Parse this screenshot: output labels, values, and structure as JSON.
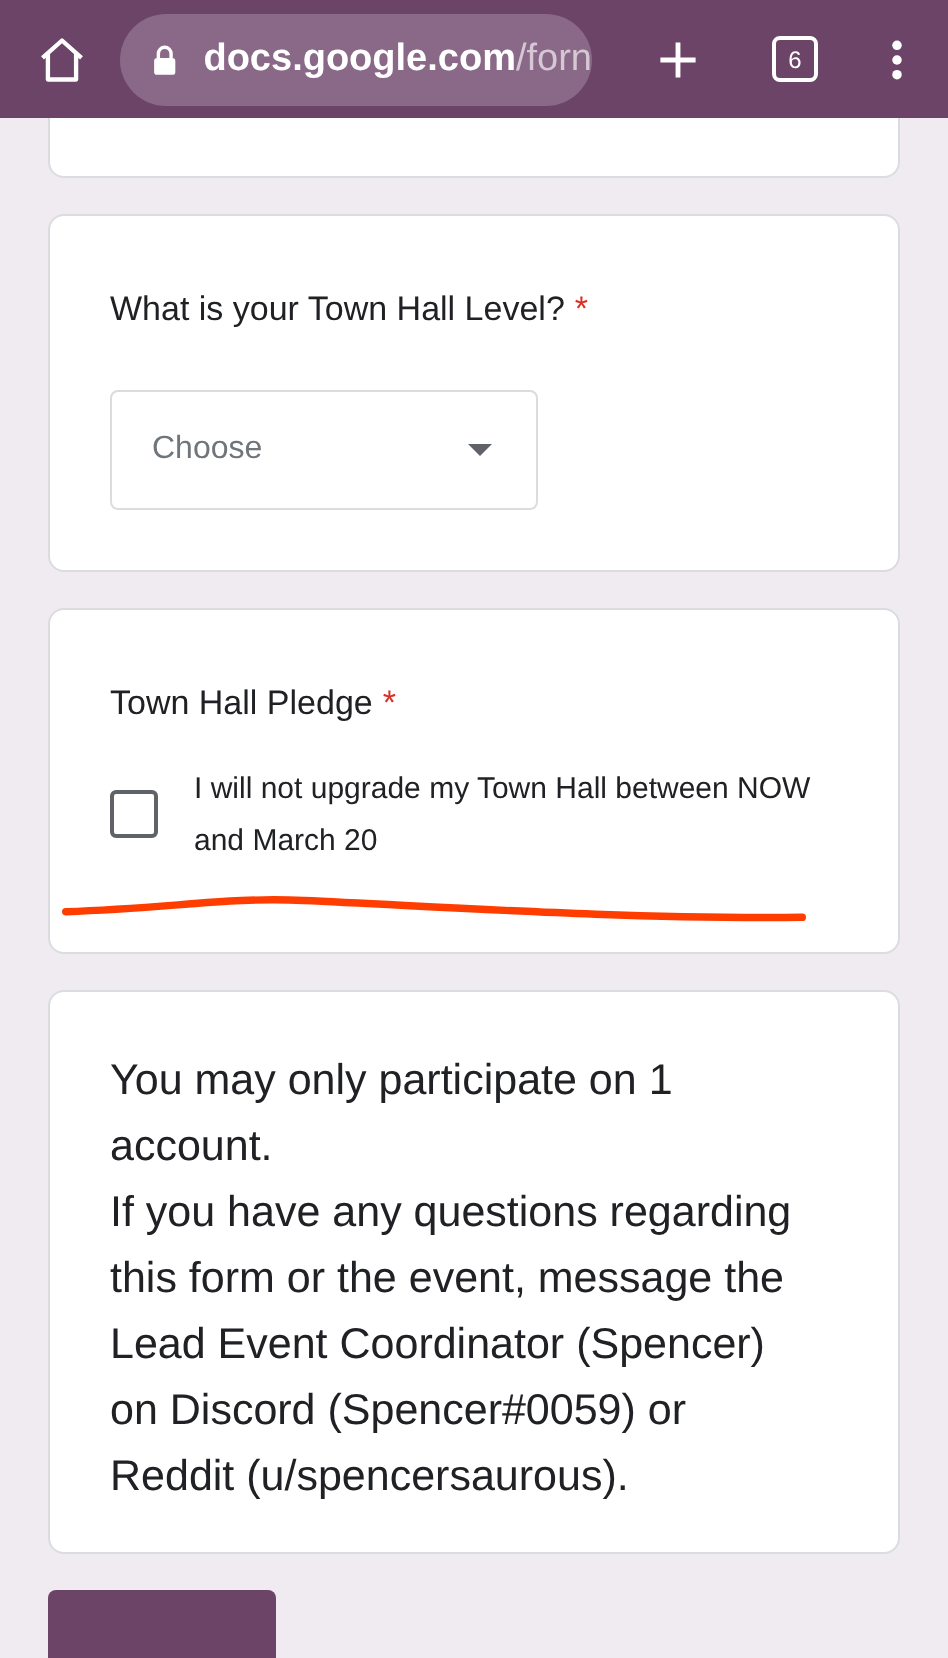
{
  "browser_bar": {
    "url_host": "docs.google.com",
    "url_path": "/forn",
    "tab_count": "6"
  },
  "questions": [
    {
      "kind": "dropdown",
      "title": "What is your Town Hall Level?",
      "required_mark": "*",
      "placeholder": "Choose"
    },
    {
      "kind": "checkbox",
      "title": "Town Hall Pledge",
      "required_mark": "*",
      "option": {
        "label": "I will not upgrade my Town Hall between NOW and March 20",
        "checked": false
      }
    }
  ],
  "notice": {
    "heading": "You may only participate on 1 account.",
    "body": "If you have any questions regarding this form or the event, message the Lead Event Coordinator (Spencer) on Discord (Spencer#0059) or Reddit (u/spencersaurous)."
  }
}
